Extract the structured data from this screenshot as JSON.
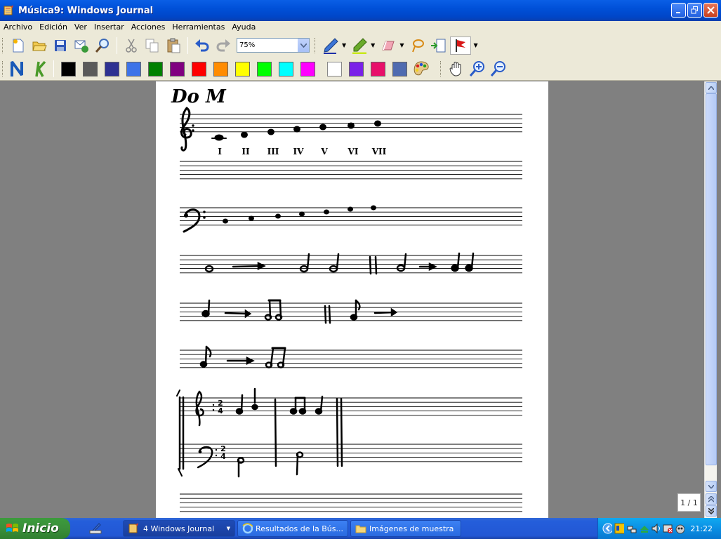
{
  "window": {
    "title": "Música9: Windows Journal"
  },
  "menu": {
    "items": [
      "Archivo",
      "Edición",
      "Ver",
      "Insertar",
      "Acciones",
      "Herramientas",
      "Ayuda"
    ]
  },
  "toolbar": {
    "zoom_value": "75%",
    "colors": [
      "#000000",
      "#5a5a5a",
      "#2e3192",
      "#3d73e8",
      "#008000",
      "#800080",
      "#ff0000",
      "#ff8c00",
      "#ffff00",
      "#00ff00",
      "#00ffff",
      "#ff00ff",
      "#ffffff",
      "#7a22e8",
      "#e8106a",
      "#4f6bb0"
    ]
  },
  "page": {
    "heading": "Do M",
    "roman_numerals": [
      "I",
      "II",
      "III",
      "IV",
      "V",
      "VI",
      "VII"
    ],
    "time_signature_top": "2",
    "time_signature_bottom": "4",
    "indicator": "1 / 1"
  },
  "taskbar": {
    "start_label": "Inicio",
    "tasks": [
      "4 Windows Journal",
      "Resultados de la Bús...",
      "Imágenes de muestra"
    ],
    "clock": "21:22"
  }
}
